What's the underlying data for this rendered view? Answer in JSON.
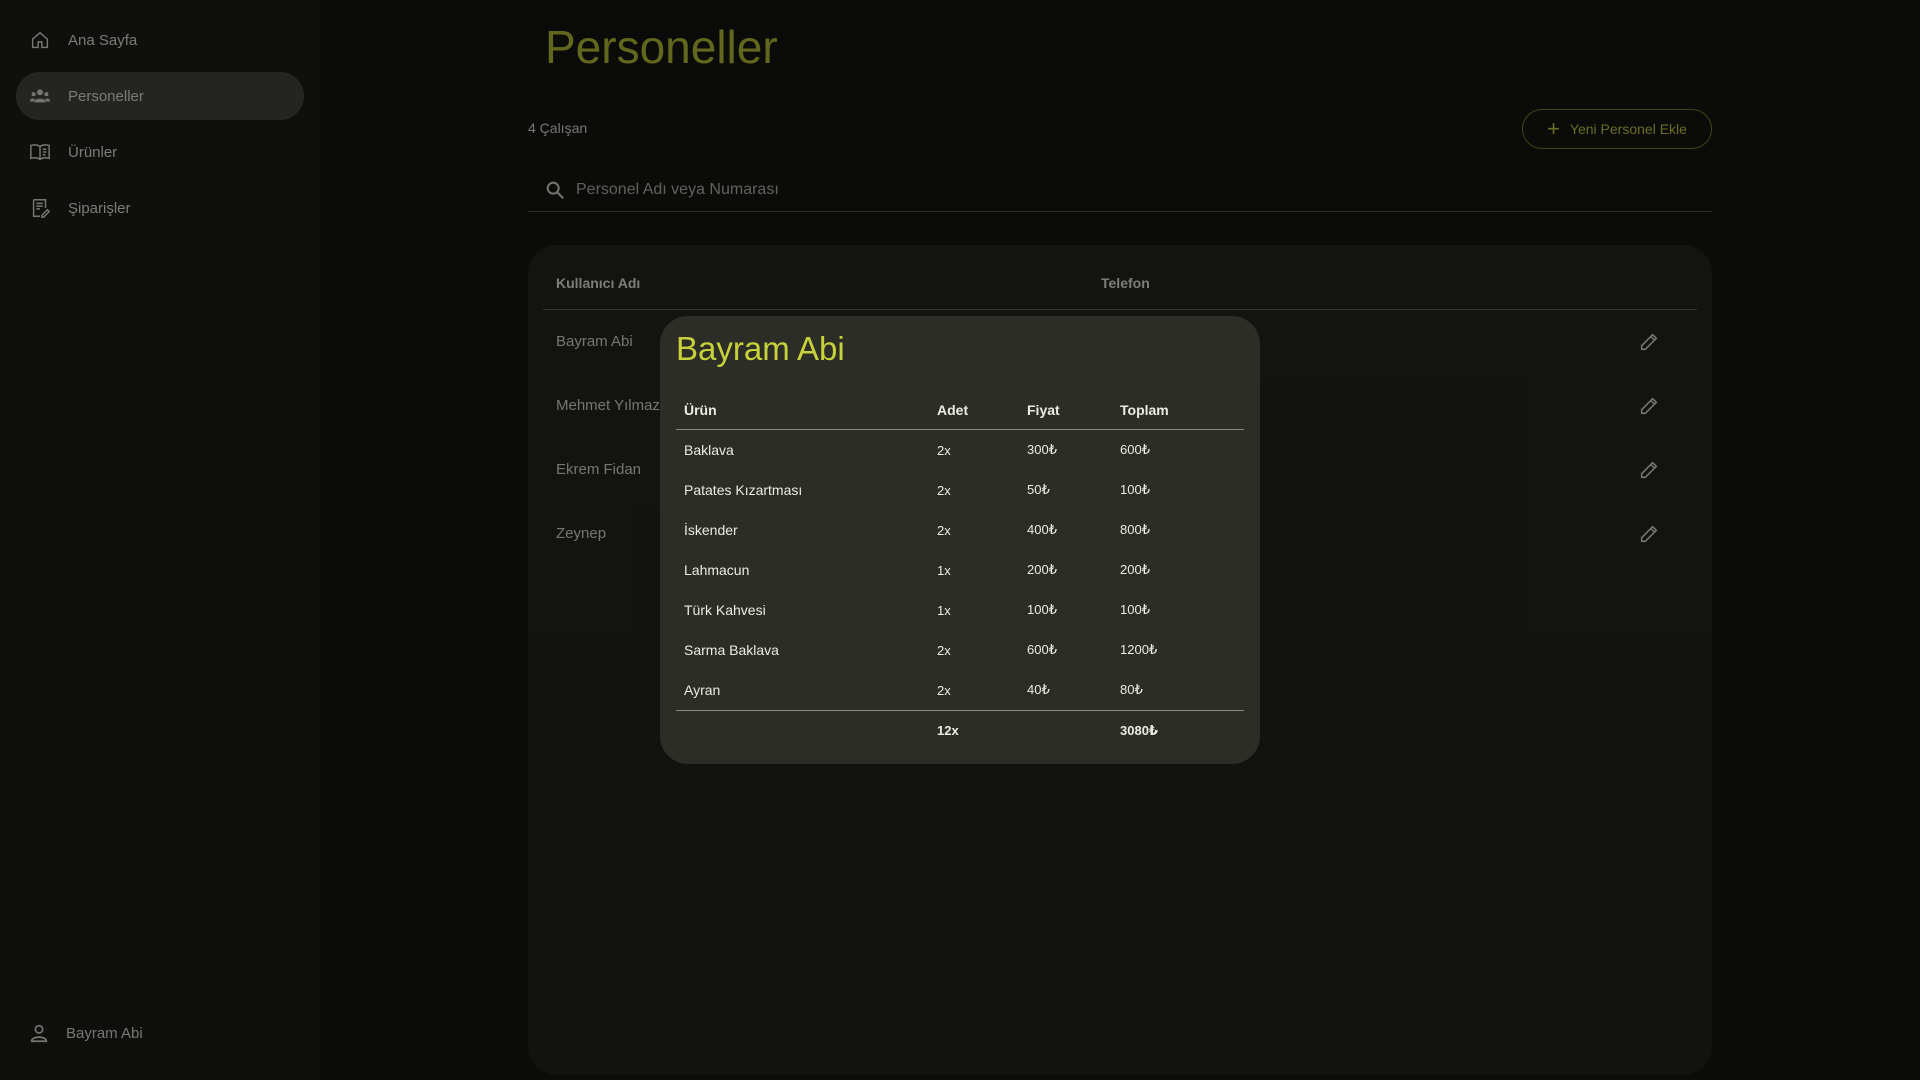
{
  "sidebar": {
    "items": [
      {
        "label": "Ana Sayfa",
        "icon": "home-icon"
      },
      {
        "label": "Personeller",
        "icon": "people-icon",
        "active": true
      },
      {
        "label": "Ürünler",
        "icon": "book-icon"
      },
      {
        "label": "Şiparişler",
        "icon": "orders-icon"
      }
    ],
    "profile": {
      "name": "Bayram Abi",
      "icon": "person-icon"
    }
  },
  "main": {
    "title": "Personeller",
    "count": "4 Çalışan",
    "add_button": "Yeni Personel Ekle",
    "search_placeholder": "Personel Adı veya Numarası",
    "table": {
      "headers": [
        "Kullanıcı Adı",
        "Telefon"
      ],
      "rows": [
        "Bayram Abi",
        "Mehmet Yılmaz",
        "Ekrem Fidan",
        "Zeynep"
      ]
    }
  },
  "modal": {
    "title": "Bayram Abi",
    "headers": [
      "Ürün",
      "Adet",
      "Fiyat",
      "Toplam"
    ],
    "rows": [
      [
        "Baklava",
        "2x",
        "300₺",
        "600₺"
      ],
      [
        "Patates Kızartması",
        "2x",
        "50₺",
        "100₺"
      ],
      [
        "İskender",
        "2x",
        "400₺",
        "800₺"
      ],
      [
        "Lahmacun",
        "1x",
        "200₺",
        "200₺"
      ],
      [
        "Türk Kahvesi",
        "1x",
        "100₺",
        "100₺"
      ],
      [
        "Sarma Baklava",
        "2x",
        "600₺",
        "1200₺"
      ],
      [
        "Ayran",
        "2x",
        "40₺",
        "80₺"
      ]
    ],
    "footer": {
      "qty": "12x",
      "total": "3080₺"
    }
  },
  "colors": {
    "accent": "#aab32e",
    "background": "#0b0b0a",
    "modal": "#2d2d28"
  }
}
